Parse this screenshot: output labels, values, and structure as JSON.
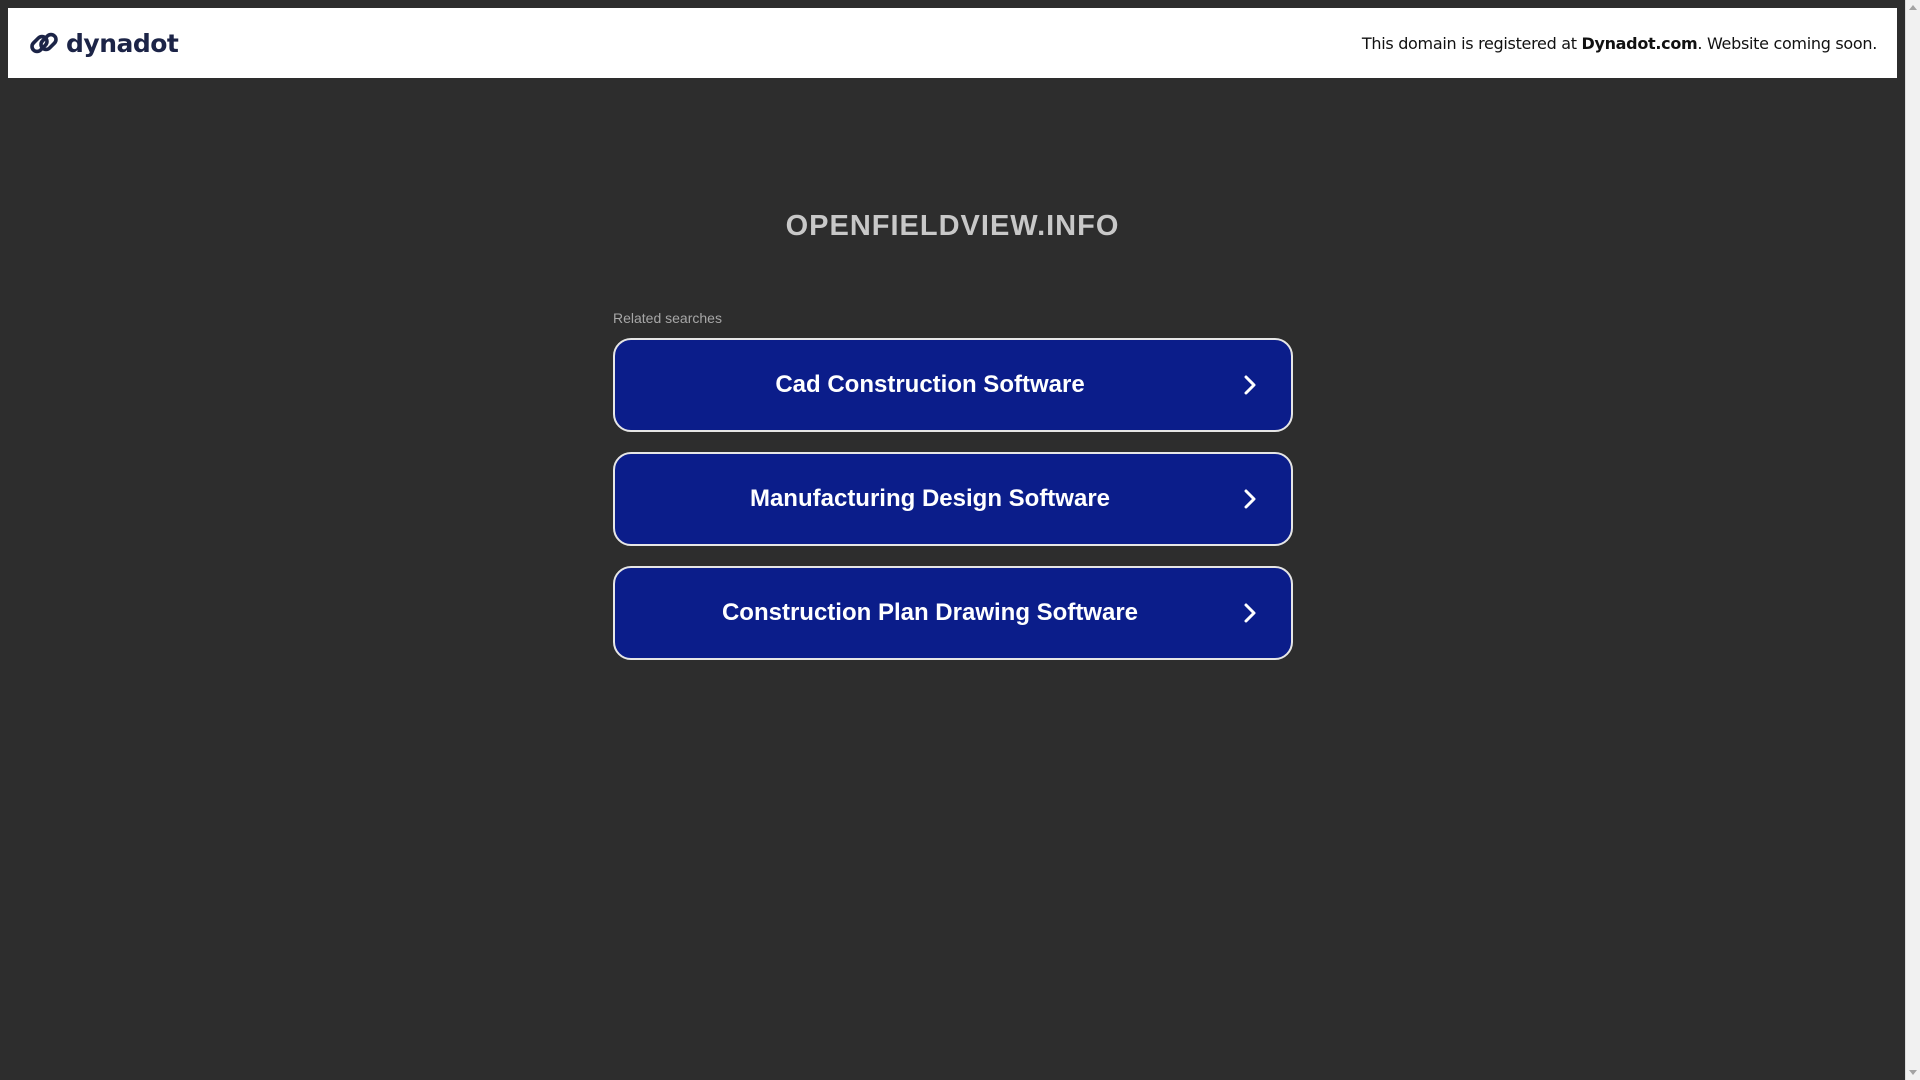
{
  "header": {
    "brand_name": "dynadot",
    "notice_prefix": "This domain is registered at ",
    "notice_brand": "Dynadot.com",
    "notice_suffix": ". Website coming soon."
  },
  "main": {
    "domain_title": "OPENFIELDVIEW.INFO",
    "related_label": "Related searches",
    "searches": [
      {
        "label": "Cad Construction Software"
      },
      {
        "label": "Manufacturing Design Software"
      },
      {
        "label": "Construction Plan Drawing Software"
      }
    ]
  },
  "colors": {
    "background": "#2d2d2d",
    "button_bg": "#0b1d8a",
    "brand_color": "#1c2447"
  },
  "icons": {
    "brand": "link-chain-icon",
    "button_arrow": "chevron-right-icon"
  }
}
